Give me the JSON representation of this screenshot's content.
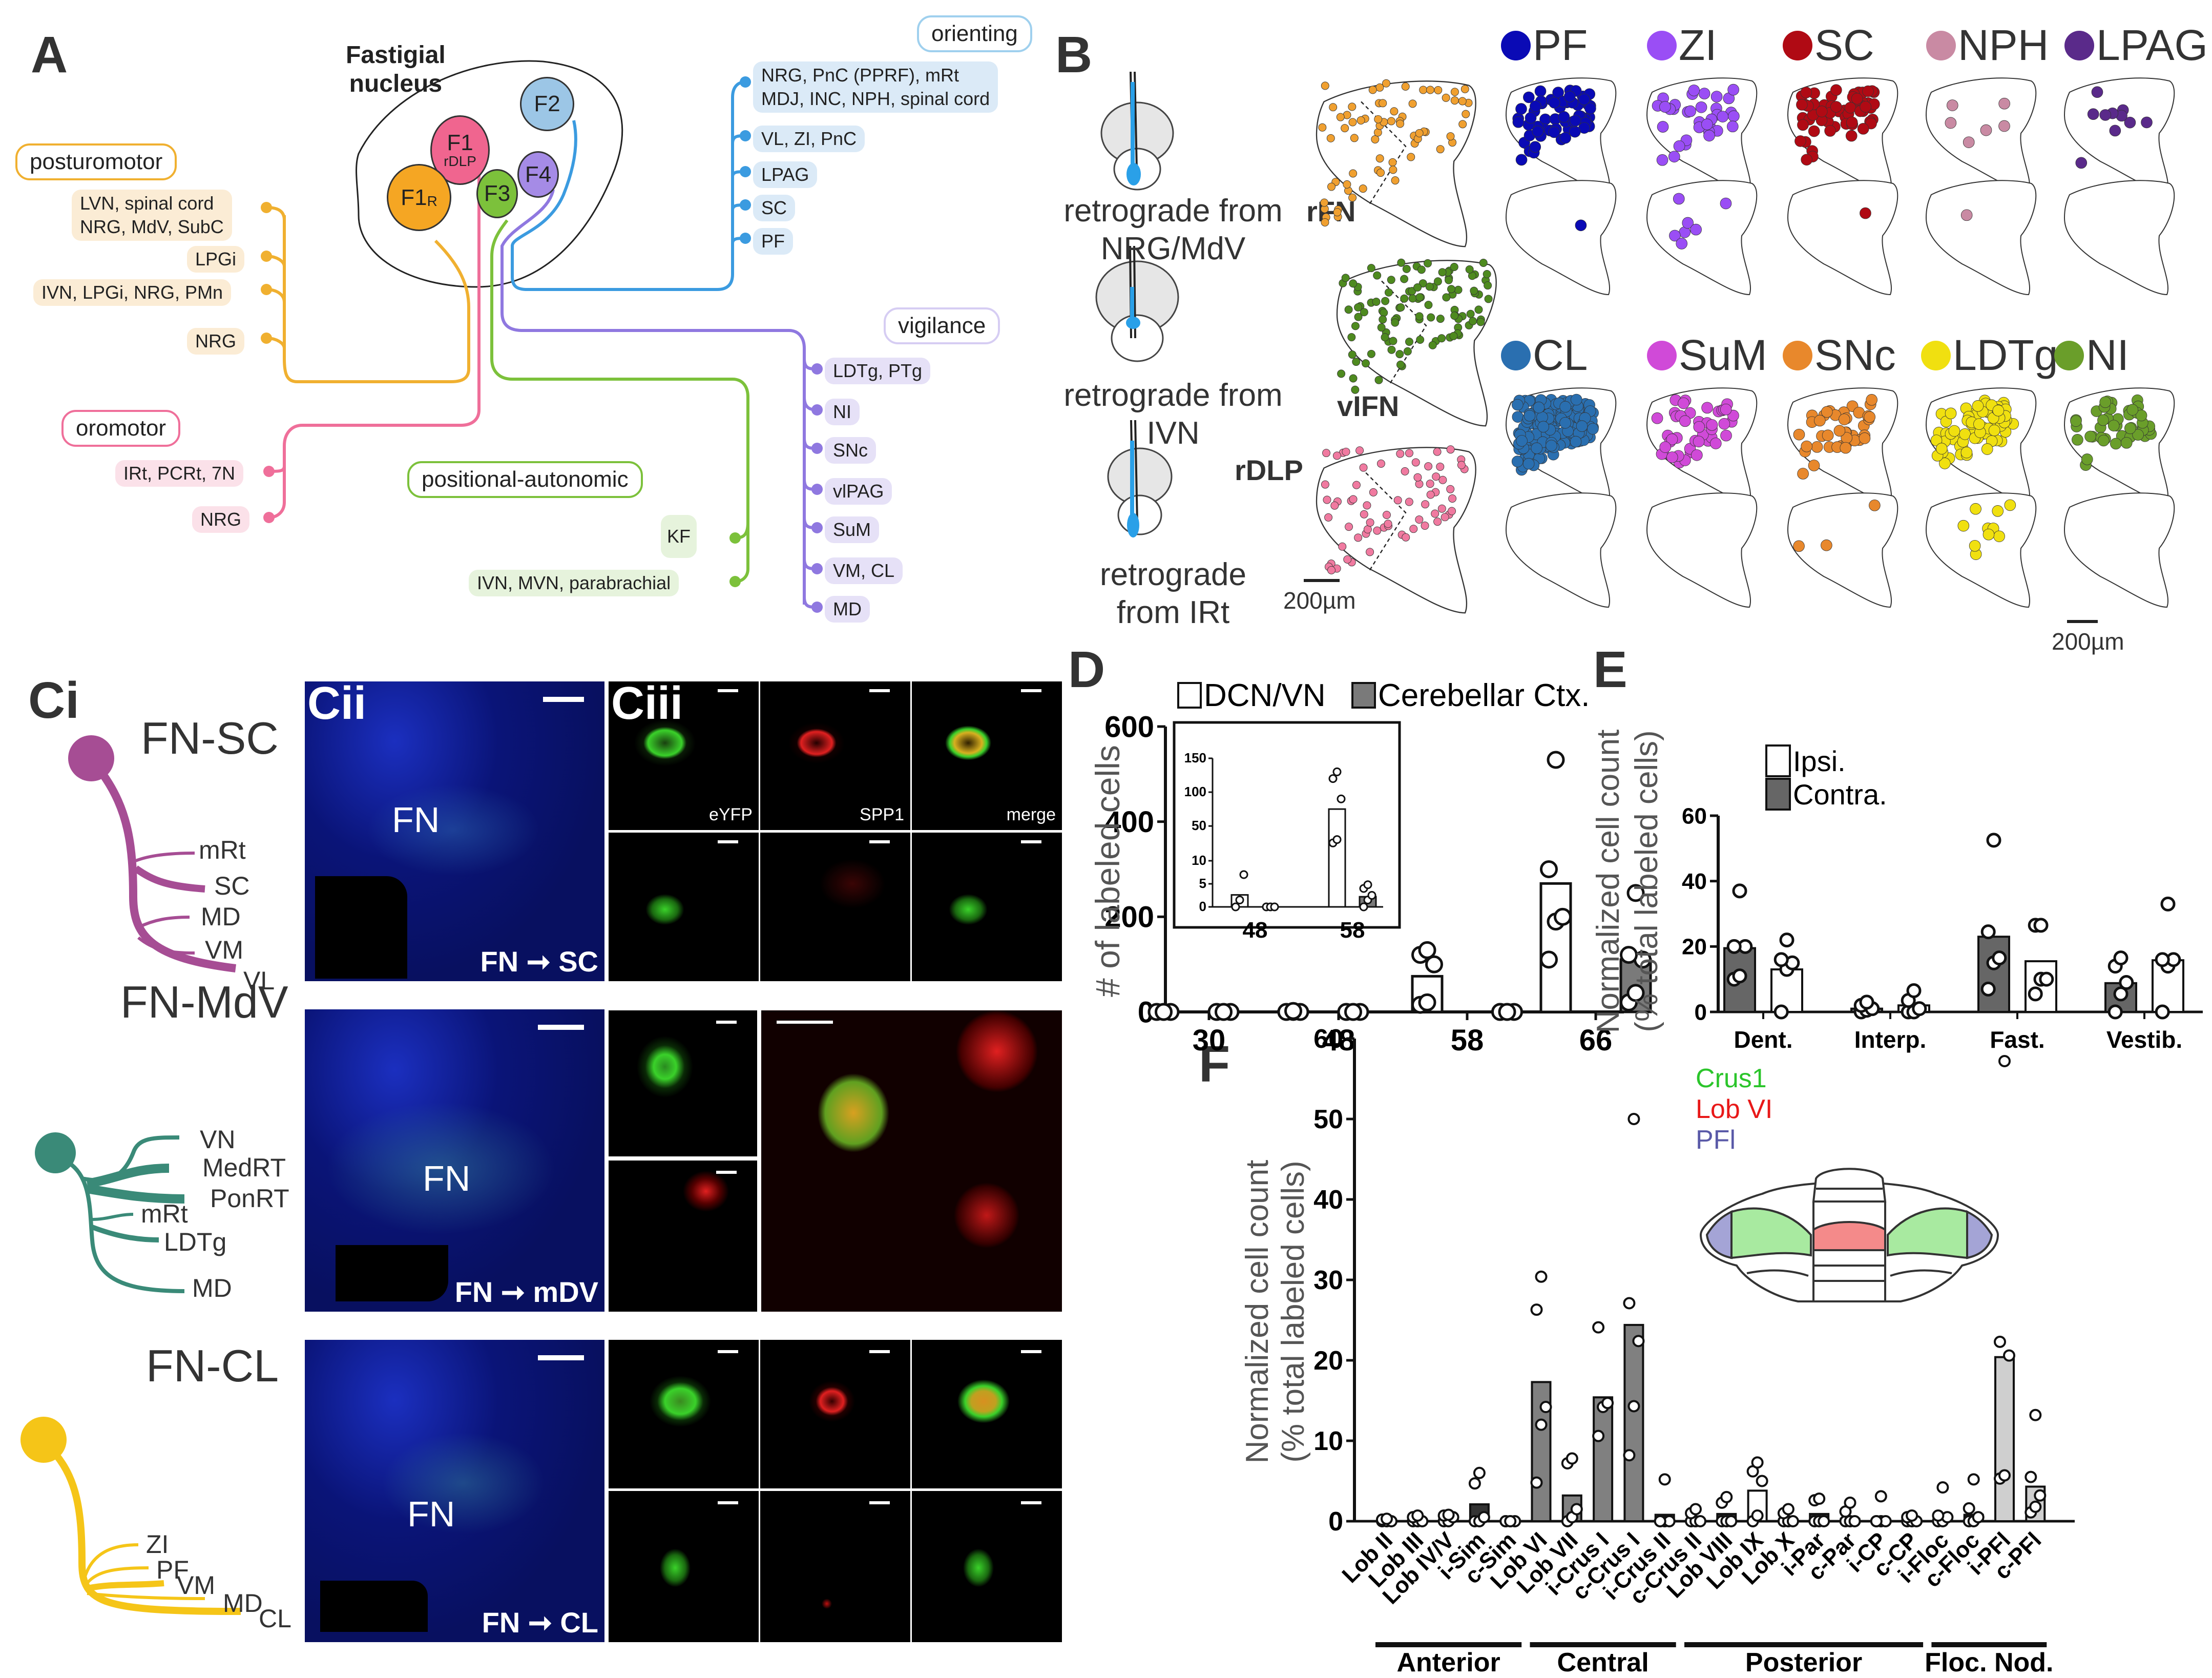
{
  "panels": {
    "A": {
      "letter": "A",
      "nucleus_title_line1": "Fastigial",
      "nucleus_title_line2": "nucleus",
      "nodes": [
        {
          "id": "F1",
          "label": "F1",
          "sub": "rDLP",
          "color": "#f0658f"
        },
        {
          "id": "F1R",
          "label": "F1",
          "sub": "R",
          "color": "#f5a623"
        },
        {
          "id": "F2",
          "label": "F2",
          "sub": "",
          "color": "#9cc6e6"
        },
        {
          "id": "F3",
          "label": "F3",
          "sub": "",
          "color": "#7cc13b"
        },
        {
          "id": "F4",
          "label": "F4",
          "sub": "",
          "color": "#a58be6"
        }
      ],
      "categories": {
        "orienting": {
          "label": "orienting",
          "color": "#3b9be0",
          "bg": "#dbeaf7"
        },
        "posturomotor": {
          "label": "posturomotor",
          "color": "#f0b030",
          "bg": "#fbecd5"
        },
        "oromotor": {
          "label": "oromotor",
          "color": "#ef6f9a",
          "bg": "#fbe1e9"
        },
        "positional_autonomic": {
          "label": "positional-autonomic",
          "color": "#7cc13b",
          "bg": "#e6f3dc"
        },
        "vigilance": {
          "label": "vigilance",
          "color": "#8f78e0",
          "bg": "#e6e1f7"
        }
      },
      "targets": {
        "orienting": [
          "NRG, PnC (PPRF), mRt",
          "MDJ, INC, NPH, spinal cord",
          "VL, ZI, PnC",
          "LPAG",
          "SC",
          "PF"
        ],
        "posturomotor": [
          "LVN, spinal cord",
          "NRG, MdV, SubC",
          "LPGi",
          "IVN, LPGi, NRG, PMn",
          "NRG"
        ],
        "oromotor": [
          "IRt, PCRt, 7N",
          "NRG"
        ],
        "positional_autonomic": [
          "KF",
          "IVN, MVN, parabrachial"
        ],
        "vigilance": [
          "LDTg, PTg",
          "NI",
          "SNc",
          "vlPAG",
          "SuM",
          "VM, CL",
          "MD"
        ]
      }
    },
    "B": {
      "letter": "B",
      "injections": [
        {
          "label_line1": "retrograde from",
          "label_line2": "NRG/MdV",
          "region": "rFN",
          "dot_color": "#f0a030"
        },
        {
          "label_line1": "retrograde from",
          "label_line2": "IVN",
          "region": "vIFN",
          "dot_color": "#4e8a1f"
        },
        {
          "label_line1": "retrograde",
          "label_line2": "from IRt",
          "region": "rDLP",
          "dot_color": "#f07aa0"
        }
      ],
      "scale_left": "200µm",
      "scale_right": "200µm",
      "legend_top": [
        {
          "label": "PF",
          "color": "#0a0ab5",
          "counts": [
            60,
            1
          ]
        },
        {
          "label": "ZI",
          "color": "#9a4ef5",
          "counts": [
            35,
            7
          ]
        },
        {
          "label": "SC",
          "color": "#b00a14",
          "counts": [
            60,
            1
          ]
        },
        {
          "label": "NPH",
          "color": "#c98aa3",
          "counts": [
            6,
            1
          ]
        },
        {
          "label": "LPAG",
          "color": "#5a2a8a",
          "counts": [
            10,
            0
          ]
        }
      ],
      "legend_bottom": [
        {
          "label": "CL",
          "color": "#2a6fb0",
          "counts": [
            200,
            0
          ]
        },
        {
          "label": "SuM",
          "color": "#d04ad8",
          "counts": [
            45,
            0
          ]
        },
        {
          "label": "SNc",
          "color": "#e8882c",
          "counts": [
            40,
            3
          ]
        },
        {
          "label": "LDTg",
          "color": "#f0e010",
          "counts": [
            70,
            10
          ]
        },
        {
          "label": "NI",
          "color": "#6a9e2a",
          "counts": [
            45,
            0
          ]
        }
      ]
    },
    "C": {
      "ci_letter": "Ci",
      "cii_letter": "Cii",
      "ciii_letter": "Ciii",
      "rows": [
        {
          "name": "FN-SC",
          "color": "#a64d94",
          "projections": [
            "mRt",
            "SC",
            "MD",
            "VM",
            "VL"
          ],
          "image_label_from": "FN",
          "image_label_to": "SC",
          "fn_label": "FN",
          "channels": [
            "eYFP",
            "SPP1",
            "merge"
          ]
        },
        {
          "name": "FN-MdV",
          "color": "#3a8a78",
          "projections": [
            "VN",
            "MedRT",
            "PonRT",
            "mRt",
            "LDTg",
            "MD"
          ],
          "image_label_from": "FN",
          "image_label_to": "mDV",
          "fn_label": "FN"
        },
        {
          "name": "FN-CL",
          "color": "#f5c518",
          "projections": [
            "ZI",
            "PF",
            "VM",
            "MD",
            "CL"
          ],
          "image_label_from": "FN",
          "image_label_to": "CL",
          "fn_label": "FN"
        }
      ]
    },
    "D": {
      "letter": "D"
    },
    "E": {
      "letter": "E"
    },
    "F": {
      "letter": "F",
      "inset_legend": [
        {
          "label": "Crus1",
          "color": "#2bc52b"
        },
        {
          "label": "Lob VI",
          "color": "#e81818"
        },
        {
          "label": "PFl",
          "color": "#5a5aa8"
        }
      ]
    }
  },
  "chart_data": [
    {
      "id": "D",
      "type": "bar",
      "title": "",
      "xlabel": "",
      "ylabel": "# of labeled cells",
      "ylim": [
        0,
        600
      ],
      "yticks": [
        0,
        200,
        400,
        600
      ],
      "categories": [
        "30",
        "48",
        "58",
        "66"
      ],
      "legend": "top",
      "series": [
        {
          "name": "DCN/VN",
          "fill": "#ffffff",
          "values": [
            0,
            1,
            75,
            270
          ],
          "points": [
            [
              0,
              0,
              0,
              0,
              0
            ],
            [
              0,
              0,
              0,
              0,
              2
            ],
            [
              15,
              20,
              100,
              120,
              130
            ],
            [
              110,
              190,
              200,
              300,
              530
            ]
          ]
        },
        {
          "name": "Cerebellar Ctx.",
          "fill": "#7a7a7a",
          "values": [
            0,
            0,
            0,
            110
          ],
          "points": [
            [
              0,
              0,
              0,
              0,
              0
            ],
            [
              0,
              0,
              0,
              0,
              0
            ],
            [
              0,
              0,
              0,
              0,
              0
            ],
            [
              20,
              40,
              110,
              120,
              250
            ]
          ]
        }
      ],
      "inset": {
        "categories": [
          "48",
          "58"
        ],
        "yticks": [
          "0",
          "5",
          "10",
          "50",
          "100",
          "150"
        ],
        "broken_axis": true,
        "series": [
          {
            "name": "DCN/VN",
            "values": [
              2.6,
              75
            ],
            "points": [
              [
                0,
                1.5,
                7
              ],
              [
                25,
                30,
                90,
                120,
                130
              ]
            ]
          },
          {
            "name": "Cerebellar Ctx.",
            "values": [
              0,
              2.2
            ],
            "points": [
              [
                0,
                0,
                0
              ],
              [
                0,
                1.5,
                2.5,
                4,
                4.8
              ]
            ]
          }
        ]
      }
    },
    {
      "id": "E",
      "type": "bar",
      "title": "",
      "xlabel": "",
      "ylabel": "Normalized cell count\n(% total labeled cells)",
      "ylabel_line1": "Normalized cell count",
      "ylabel_line2": "(% total labeled cells)",
      "ylim": [
        0,
        60
      ],
      "yticks": [
        0,
        20,
        40,
        60
      ],
      "categories": [
        "Dent.",
        "Interp.",
        "Fast.",
        "Vestib."
      ],
      "legend": "top-left",
      "series": [
        {
          "name": "Contra.",
          "fill": "#666666",
          "values": [
            19.5,
            1.0,
            23.0,
            8.8
          ],
          "points": [
            [
              10,
              11,
              20,
              20,
              37
            ],
            [
              0,
              0.5,
              1,
              2,
              3
            ],
            [
              7,
              15,
              16.5,
              24.5,
              52.5
            ],
            [
              0,
              5.5,
              9,
              14,
              16.5
            ]
          ]
        },
        {
          "name": "Ipsi.",
          "fill": "#ffffff",
          "values": [
            13.0,
            2.0,
            15.5,
            15.8
          ],
          "points": [
            [
              0,
              13,
              15,
              16,
              22
            ],
            [
              0,
              0,
              1,
              3.5,
              6.5
            ],
            [
              5.5,
              10,
              10,
              26.5,
              26.5
            ],
            [
              0,
              14,
              16,
              16,
              33
            ]
          ]
        }
      ]
    },
    {
      "id": "F",
      "type": "bar",
      "title": "",
      "xlabel": "",
      "ylabel_line1": "Normalized cell count",
      "ylabel_line2": "(% total labeled cells)",
      "ylim": [
        0,
        60
      ],
      "yticks": [
        0,
        10,
        20,
        30,
        40,
        50,
        60
      ],
      "categories": [
        "Lob II",
        "Lob III",
        "Lob IV/V",
        "i-Sim",
        "c-Sim",
        "Lob VI",
        "Lob VII",
        "i-Crus I",
        "c-Crus I",
        "i-Crus II",
        "c-Crus II",
        "Lob VIII",
        "Lob IX",
        "Lob X",
        "i-Par",
        "c-Par",
        "i-CP",
        "c-CP",
        "i-Floc",
        "c-Floc",
        "i-PFl",
        "c-PFl"
      ],
      "groups": [
        {
          "label": "Anterior",
          "from": 0,
          "to": 4
        },
        {
          "label": "Central",
          "from": 5,
          "to": 9
        },
        {
          "label": "Posterior",
          "from": 10,
          "to": 17
        },
        {
          "label": "Floc. Nod.",
          "from": 18,
          "to": 21
        }
      ],
      "values": [
        0.1,
        0.2,
        0.3,
        2.1,
        0.1,
        17.3,
        3.2,
        15.4,
        24.4,
        0.8,
        0.2,
        0.9,
        3.8,
        0.2,
        0.9,
        0.3,
        0.1,
        0.1,
        0.3,
        0.8,
        20.4,
        4.3
      ],
      "fills": [
        "#ffffff",
        "#ffffff",
        "#ffffff",
        "#333333",
        "#ffffff",
        "#808080",
        "#808080",
        "#808080",
        "#808080",
        "#808080",
        "#ffffff",
        "#333333",
        "#ffffff",
        "#ffffff",
        "#333333",
        "#ffffff",
        "#ffffff",
        "#ffffff",
        "#ffffff",
        "#333333",
        "#cfcfcf",
        "#cfcfcf"
      ],
      "points": [
        [
          0,
          0,
          0,
          0.2,
          0.3
        ],
        [
          0,
          0,
          0,
          0.5,
          0.7
        ],
        [
          0,
          0,
          0.5,
          0.7,
          0.8
        ],
        [
          0,
          0,
          0.5,
          4.7,
          6
        ],
        [
          0,
          0,
          0,
          0,
          0
        ],
        [
          4.8,
          12,
          14.2,
          26.3,
          30.4
        ],
        [
          0,
          0.5,
          1.5,
          7.2,
          7.8
        ],
        [
          10.6,
          14.2,
          14.7,
          24.1
        ],
        [
          8.2,
          14.3,
          22.4,
          27.1,
          50
        ],
        [
          0,
          0,
          0,
          0,
          5.2
        ],
        [
          0,
          0,
          0,
          1,
          1.5
        ],
        [
          0,
          0,
          0,
          2.3,
          3
        ],
        [
          0,
          0.7,
          5,
          6.2,
          7.3
        ],
        [
          0,
          0,
          0,
          1,
          1.5
        ],
        [
          0,
          0,
          0,
          2.6,
          2.8
        ],
        [
          0,
          0,
          0,
          1.2,
          2.3
        ],
        [
          0,
          0,
          0,
          0,
          3.1
        ],
        [
          0,
          0,
          0,
          0.5,
          0.7
        ],
        [
          0,
          0,
          0.5,
          0.7,
          4.2
        ],
        [
          0,
          0,
          0.5,
          1.6,
          5.2
        ],
        [
          5.3,
          5.7,
          20.6,
          22.3,
          57.2
        ],
        [
          1.1,
          1.8,
          3.2,
          5.5,
          13.2
        ]
      ]
    }
  ]
}
